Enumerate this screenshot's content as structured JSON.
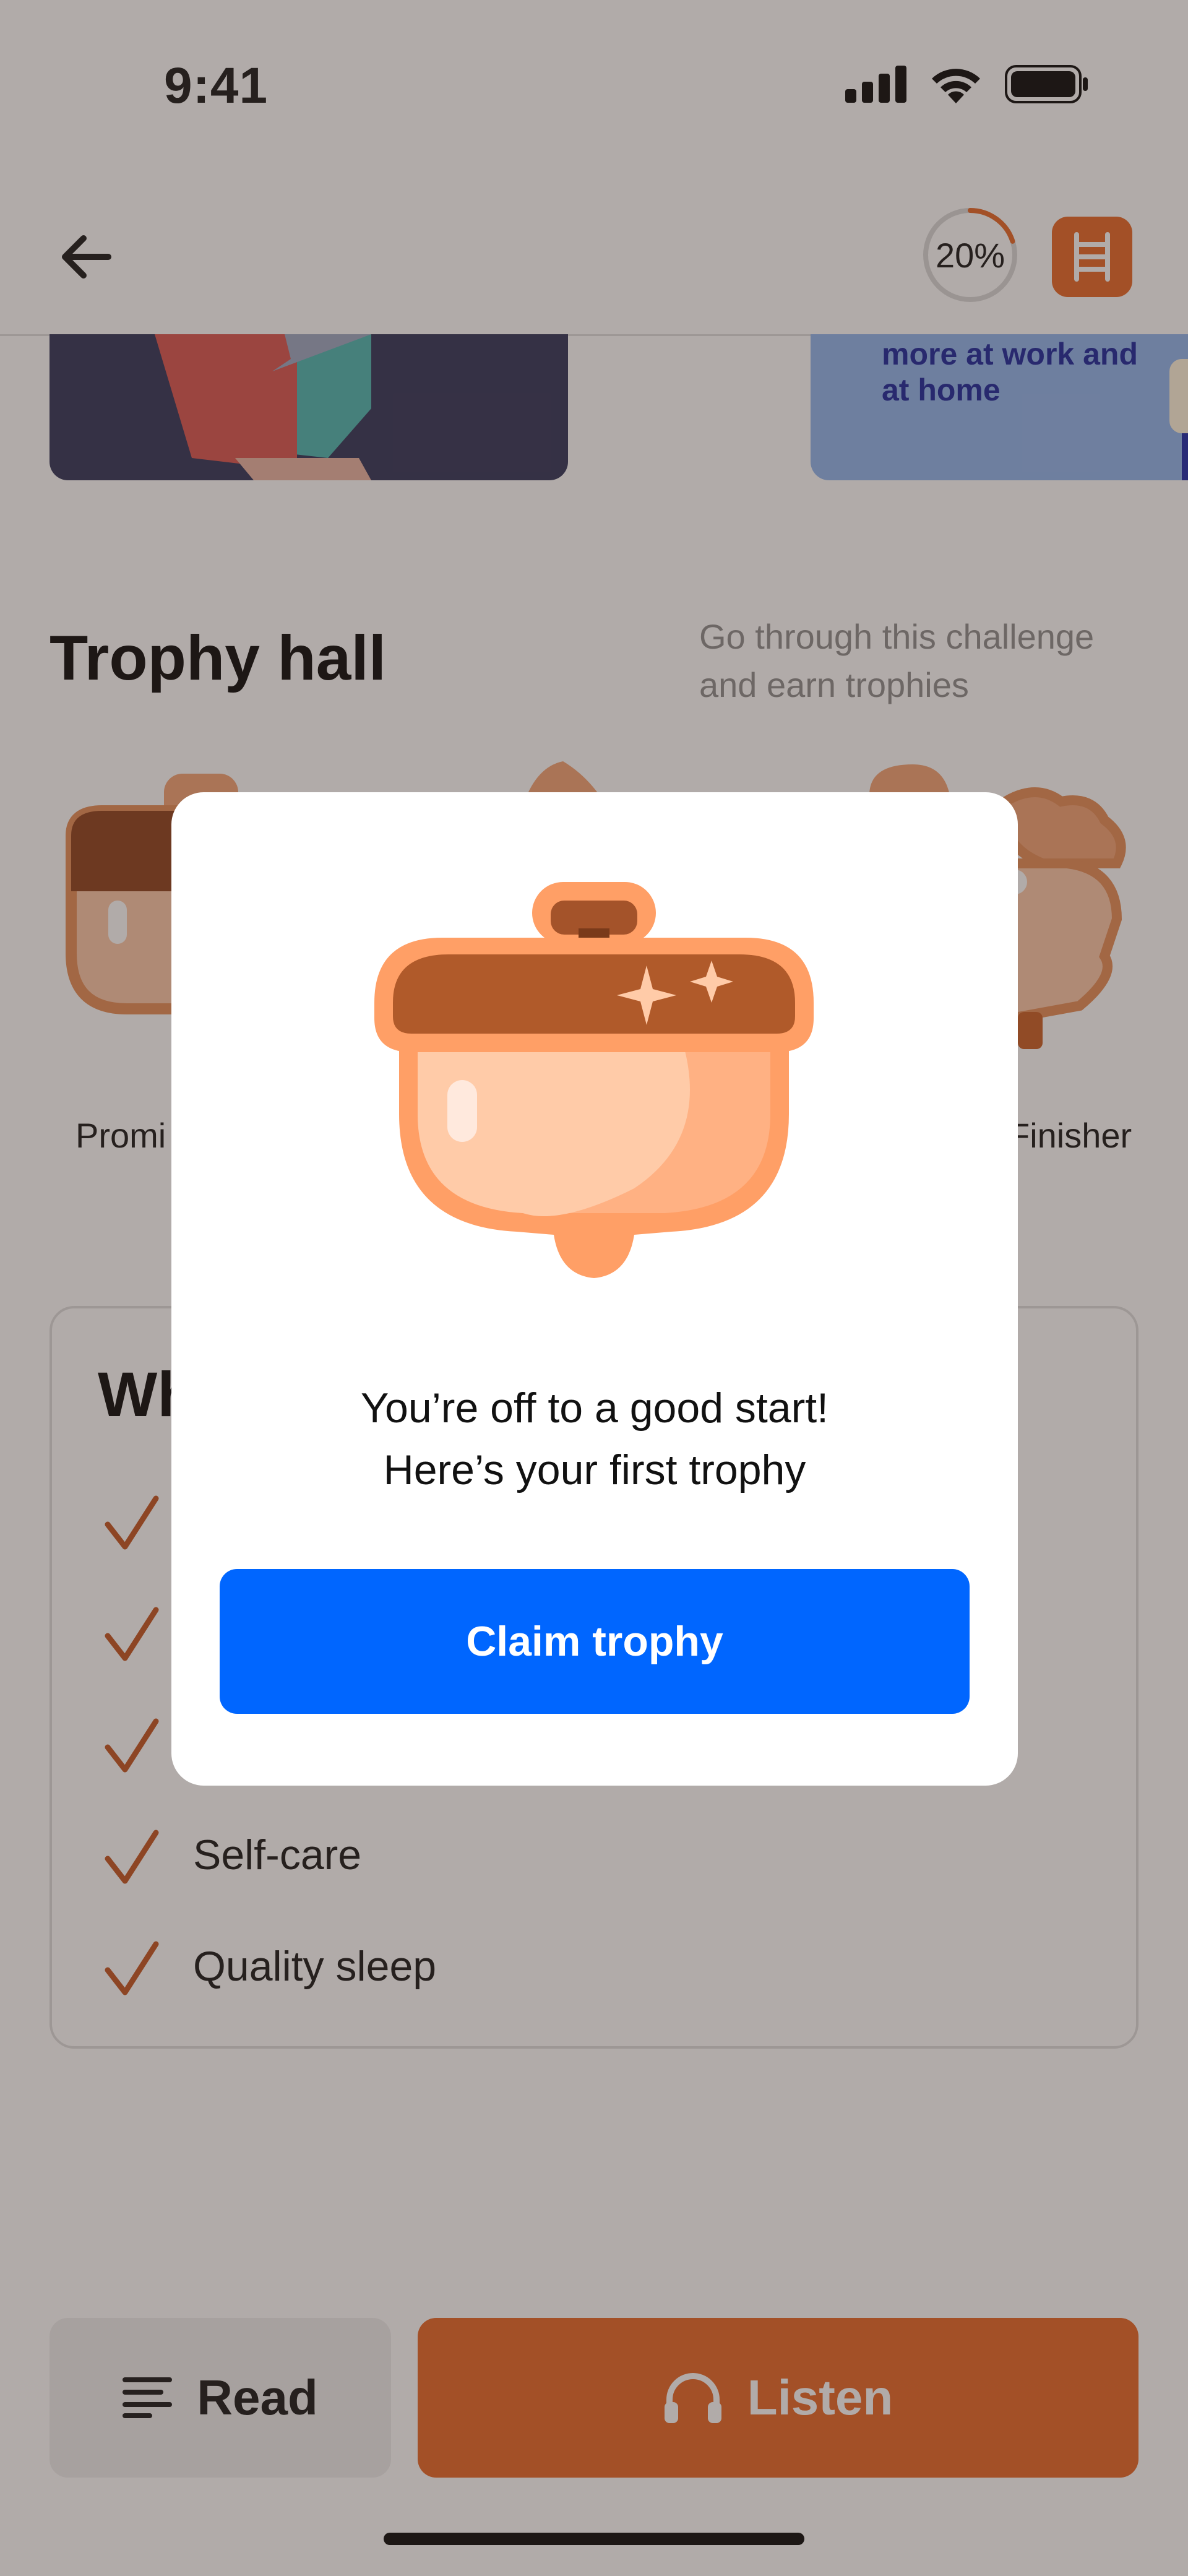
{
  "status_bar": {
    "time": "9:41",
    "icons": [
      "signal-icon",
      "wifi-icon",
      "battery-icon"
    ]
  },
  "header": {
    "back_icon": "back-arrow-icon",
    "progress": 20,
    "progress_label": "20%",
    "ladder_icon": "ladder-icon"
  },
  "carousel": {
    "right_card_text": "more at work and at home"
  },
  "trophy_hall": {
    "title": "Trophy hall",
    "subtitle": "Go through this challenge and earn trophies",
    "labels": {
      "left": "Promi",
      "right": "Finisher"
    }
  },
  "benefits": {
    "title": "Wh",
    "items": [
      "Self-care",
      "Quality sleep"
    ]
  },
  "bottom_bar": {
    "read_label": "Read",
    "listen_label": "Listen"
  },
  "modal": {
    "message_line1": "You’re off to a good start!",
    "message_line2": "Here’s your first trophy",
    "claim_label": "Claim trophy"
  },
  "colors": {
    "accent": "#e7621f",
    "primary_button": "#0066ff",
    "overlay": "#463732"
  }
}
